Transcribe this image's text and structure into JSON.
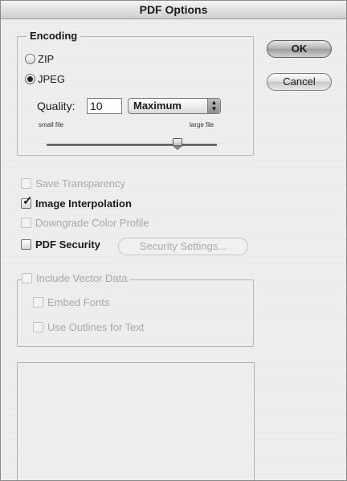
{
  "window": {
    "title": "PDF Options"
  },
  "encoding": {
    "legend": "Encoding",
    "options": [
      {
        "label": "ZIP",
        "selected": false
      },
      {
        "label": "JPEG",
        "selected": true
      }
    ],
    "quality_label": "Quality:",
    "quality_value": "10",
    "quality_preset": "Maximum",
    "slider_min_label": "small file",
    "slider_max_label": "large file",
    "slider_position": 0.77
  },
  "buttons": {
    "ok": "OK",
    "cancel": "Cancel"
  },
  "options": {
    "save_transparency": {
      "label": "Save Transparency",
      "checked": false,
      "enabled": false
    },
    "image_interpolation": {
      "label": "Image Interpolation",
      "checked": true,
      "enabled": true
    },
    "downgrade_color_profile": {
      "label": "Downgrade Color Profile",
      "checked": false,
      "enabled": false
    },
    "pdf_security": {
      "label": "PDF Security",
      "checked": false,
      "enabled": true
    },
    "security_settings_button": "Security Settings..."
  },
  "vector": {
    "legend_label": "Include Vector Data",
    "embed_fonts": "Embed Fonts",
    "use_outlines": "Use Outlines for Text"
  }
}
